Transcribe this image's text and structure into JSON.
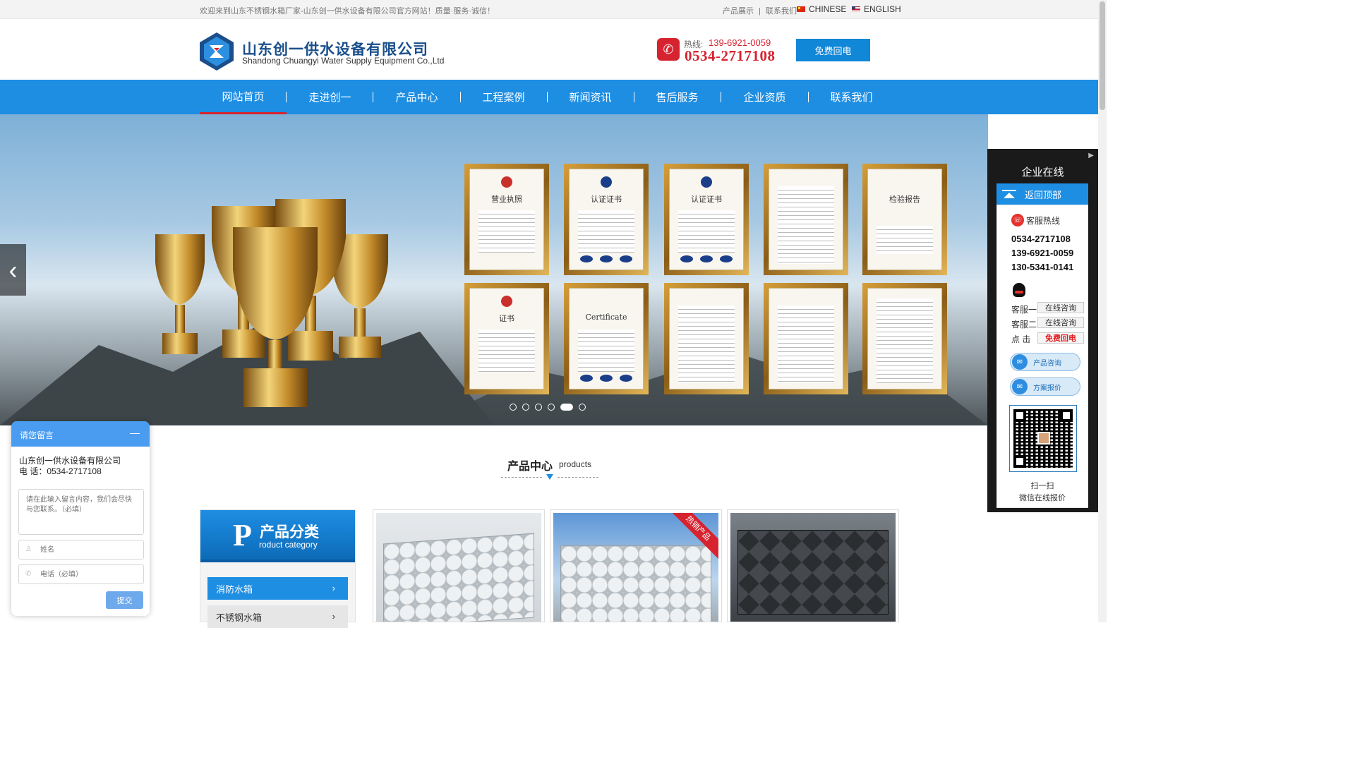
{
  "topbar": {
    "welcome": "欢迎来到山东不锈钢水箱厂家-山东创一供水设备有限公司官方网站！质量·服务·诚信！",
    "link_products": "产品展示",
    "divider": "|",
    "link_contact": "联系我们",
    "lang_cn": "CHINESE",
    "lang_en": "ENGLISH"
  },
  "header": {
    "company_cn": "山东创一供水设备有限公司",
    "company_en": "Shandong Chuangyi Water Supply Equipment Co.,Ltd",
    "hotline_label": "热线:",
    "mobile": "139-6921-0059",
    "tel": "0534-2717108",
    "callback_label": "免费回电",
    "brand_color": "#1187d8",
    "accent_red": "#d7232f"
  },
  "nav": {
    "items": [
      {
        "label": "网站首页",
        "active": true
      },
      {
        "label": "走进创一"
      },
      {
        "label": "产品中心"
      },
      {
        "label": "工程案例"
      },
      {
        "label": "新闻资讯"
      },
      {
        "label": "售后服务"
      },
      {
        "label": "企业资质"
      },
      {
        "label": "联系我们"
      }
    ]
  },
  "banner": {
    "prev_icon": "chevron-left-icon",
    "slides_total": 6,
    "active_slide": 5,
    "cert_titles": [
      "营业执照",
      "认证证书",
      "认证证书",
      "",
      "检验报告",
      "证书",
      "Certificate",
      "",
      "",
      ""
    ]
  },
  "products": {
    "title": "产品中心",
    "subtitle": "products",
    "category_title": "产品分类",
    "category_letter": "P",
    "category_en": "roduct category",
    "categories": [
      "消防水箱",
      "不锈钢水箱"
    ],
    "hot_label": "热销产品"
  },
  "float": {
    "title": "企业在线",
    "back_top": "返回顶部",
    "hotline_label": "客服热线",
    "numbers": [
      "0534-2717108",
      "139-6921-0059",
      "130-5341-0141"
    ],
    "service1": "客服一",
    "service2": "客服二",
    "online_btn": "在线咨询",
    "click_label": "点 击",
    "callback": "免费回电",
    "pill1": "产品咨询",
    "pill2": "方案报价",
    "scan": "扫一扫",
    "wechat": "微信在线报价"
  },
  "message": {
    "title": "请您留言",
    "minimize": "—",
    "company": "山东创一供水设备有限公司",
    "tel": "电 话：0534-2717108",
    "content_placeholder": "请在此输入留言内容，我们会尽快与您联系。（必填）",
    "name_placeholder": "姓名",
    "phone_placeholder": "电话（必填）",
    "submit": "提交"
  }
}
